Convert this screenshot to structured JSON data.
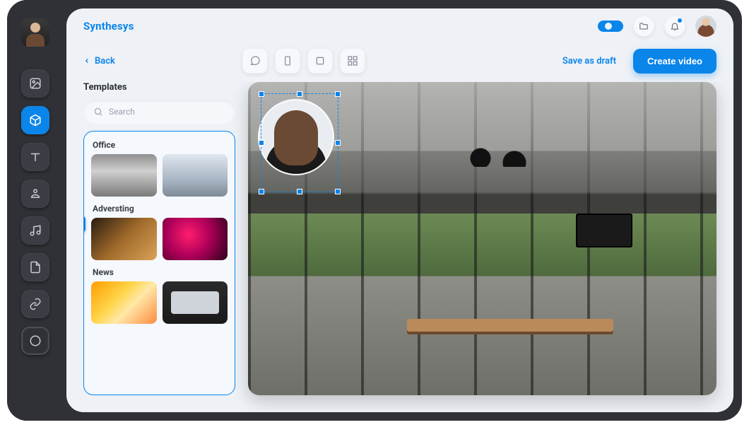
{
  "brand": "Synthesys",
  "topbar": {
    "badge_label": "",
    "folder_tip": "Projects",
    "bell_tip": "Notifications"
  },
  "actions": {
    "back": "Back",
    "save_draft": "Save as draft",
    "create": "Create video"
  },
  "panel": {
    "title": "Templates",
    "search_placeholder": "Search",
    "categories": [
      {
        "label": "Office"
      },
      {
        "label": "Adversting"
      },
      {
        "label": "News"
      }
    ]
  },
  "rail": {
    "items": [
      {
        "name": "image-icon"
      },
      {
        "name": "cube-icon",
        "active": true
      },
      {
        "name": "text-icon"
      },
      {
        "name": "person-icon"
      },
      {
        "name": "music-icon"
      },
      {
        "name": "document-icon"
      },
      {
        "name": "link-icon"
      },
      {
        "name": "circle-icon"
      }
    ]
  },
  "colors": {
    "accent": "#0a85ea",
    "shell": "#2f3136",
    "surface": "#eef1f6"
  }
}
